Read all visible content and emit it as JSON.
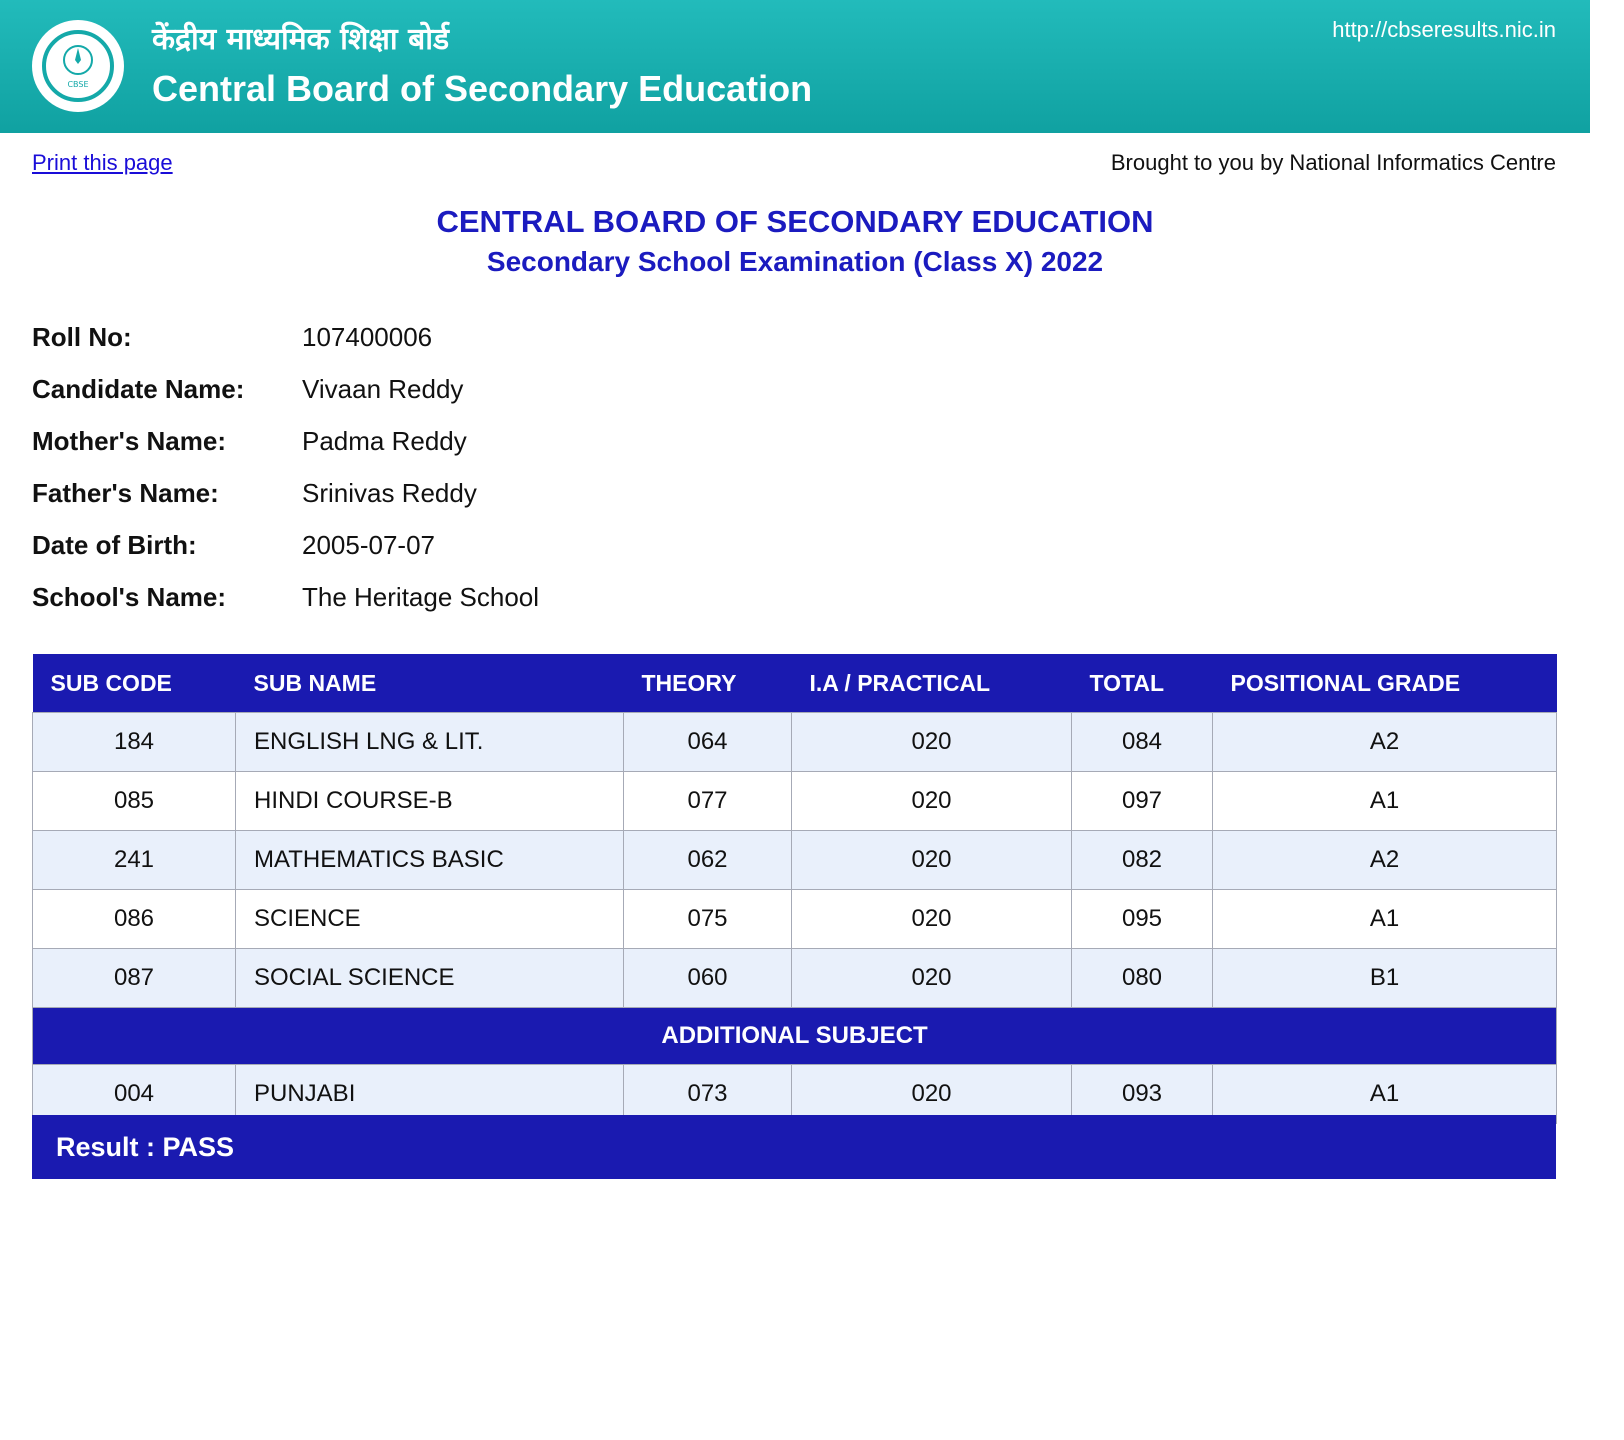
{
  "header": {
    "hindi_title": "केंद्रीय माध्यमिक शिक्षा बोर्ड",
    "english_title": "Central Board of Secondary Education",
    "url": "http://cbseresults.nic.in",
    "logo_text": "CBSE",
    "accent_color": "#14a9a9"
  },
  "toolbar": {
    "print_label": "Print this page",
    "credit": "Brought to you by National Informatics Centre"
  },
  "titles": {
    "board": "CENTRAL BOARD OF SECONDARY EDUCATION",
    "exam": "Secondary School Examination (Class X) 2022"
  },
  "candidate": [
    {
      "label": "Roll No:",
      "value": "107400006"
    },
    {
      "label": "Candidate Name:",
      "value": "Vivaan Reddy"
    },
    {
      "label": "Mother's Name:",
      "value": "Padma Reddy"
    },
    {
      "label": "Father's Name:",
      "value": "Srinivas Reddy"
    },
    {
      "label": "Date of Birth:",
      "value": "2005-07-07"
    },
    {
      "label": "School's Name:",
      "value": "The Heritage School"
    }
  ],
  "table": {
    "header_color": "#1a1ab0",
    "headers": [
      "SUB CODE",
      "SUB NAME",
      "THEORY",
      "I.A / PRACTICAL",
      "TOTAL",
      "POSITIONAL GRADE"
    ],
    "rows": [
      {
        "code": "184",
        "name": "ENGLISH LNG & LIT.",
        "theory": "064",
        "practical": "020",
        "total": "084",
        "grade": "A2"
      },
      {
        "code": "085",
        "name": "HINDI COURSE-B",
        "theory": "077",
        "practical": "020",
        "total": "097",
        "grade": "A1"
      },
      {
        "code": "241",
        "name": "MATHEMATICS BASIC",
        "theory": "062",
        "practical": "020",
        "total": "082",
        "grade": "A2"
      },
      {
        "code": "086",
        "name": "SCIENCE",
        "theory": "075",
        "practical": "020",
        "total": "095",
        "grade": "A1"
      },
      {
        "code": "087",
        "name": "SOCIAL SCIENCE",
        "theory": "060",
        "practical": "020",
        "total": "080",
        "grade": "B1"
      }
    ],
    "additional_label": "ADDITIONAL SUBJECT",
    "additional_rows": [
      {
        "code": "004",
        "name": "PUNJABI",
        "theory": "073",
        "practical": "020",
        "total": "093",
        "grade": "A1"
      }
    ]
  },
  "result": {
    "text": "Result : PASS"
  }
}
